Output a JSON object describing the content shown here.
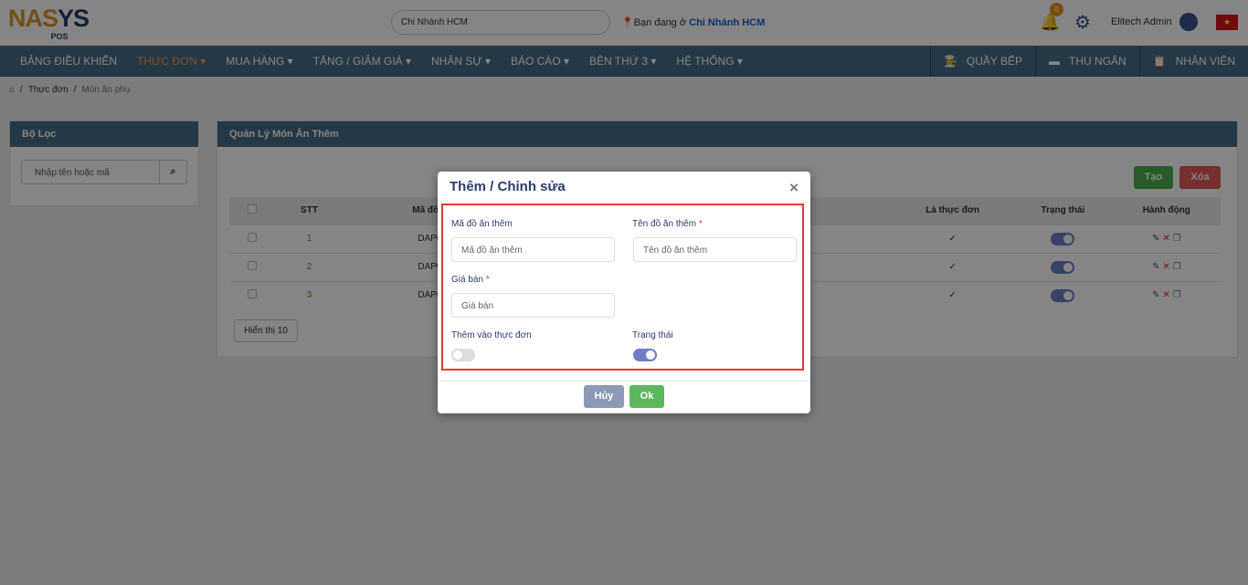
{
  "logo": {
    "text_a": "NA",
    "text_s": "S",
    "text_b": "YS",
    "sub": "POS"
  },
  "header": {
    "branch_select": "Chi Nhánh HCM",
    "location_prefix": "Bạn đang ở",
    "location_branch": "Chi Nhánh HCM",
    "notification_count": "0",
    "user_name": "Elitech Admin"
  },
  "nav": {
    "items": [
      {
        "label": "BẢNG ĐIỀU KHIỂN"
      },
      {
        "label": "THỰC ĐƠN ▾"
      },
      {
        "label": "MUA HÀNG ▾"
      },
      {
        "label": "TĂNG / GIẢM GIÁ ▾"
      },
      {
        "label": "NHÂN SỰ ▾"
      },
      {
        "label": "BÁO CÁO ▾"
      },
      {
        "label": "BÊN THỨ 3 ▾"
      },
      {
        "label": "HỆ THỐNG ▾"
      }
    ],
    "active": "THỰC ĐƠN",
    "right": [
      {
        "label": "QUẦY BẾP"
      },
      {
        "label": "THU NGÂN"
      },
      {
        "label": "NHÂN VIÊN"
      }
    ]
  },
  "breadcrumb": {
    "items": [
      "Thực đơn",
      "Món ăn phụ"
    ]
  },
  "filter": {
    "title": "Bộ Lọc",
    "search_placeholder": "Nhập tên hoặc mã"
  },
  "main": {
    "title": "Quản Lý Món Ăn Thêm",
    "create": "Tạo",
    "delete": "Xóa",
    "columns": {
      "stt": "STT",
      "code": "Mã đồ ăn t",
      "is_menu": "Là thực đơn",
      "status": "Trạng thái",
      "actions": "Hành động"
    },
    "rows": [
      {
        "stt": "1",
        "code": "DAP000",
        "is_menu": "✓",
        "status": true
      },
      {
        "stt": "2",
        "code": "DAP000",
        "is_menu": "✓",
        "status": true
      },
      {
        "stt": "3",
        "code": "DAP000",
        "is_menu": "✓",
        "status": true
      }
    ],
    "page_size": "Hiển thị 10"
  },
  "modal": {
    "title": "Thêm / Chỉnh sửa",
    "code_label": "Mã đồ ăn thêm",
    "code_placeholder": "Mã đồ ăn thêm",
    "name_label": "Tên đồ ăn thêm",
    "name_placeholder": "Tên đồ ăn thêm",
    "price_label": "Giá bán",
    "price_placeholder": "Giá bán",
    "add_menu_label": "Thêm vào thực đơn",
    "add_menu_on": false,
    "status_label": "Trạng thái",
    "status_on": true,
    "required": "*",
    "cancel": "Hủy",
    "ok": "Ok"
  },
  "colors": {
    "nav": "#466b85",
    "accent": "#f5a04a",
    "create": "#4caf50",
    "delete": "#e05a5a",
    "highlight": "#e53935"
  }
}
